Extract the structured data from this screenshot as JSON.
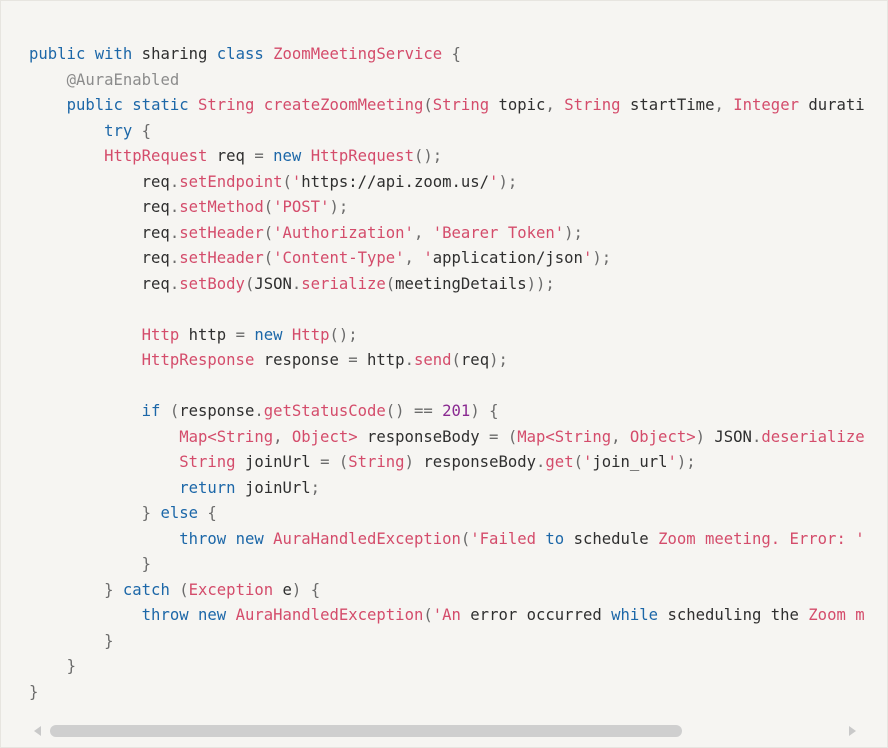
{
  "code_lines": [
    [
      [
        "kw",
        "public"
      ],
      [
        "plain",
        " "
      ],
      [
        "kw",
        "with"
      ],
      [
        "plain",
        " sharing "
      ],
      [
        "kw",
        "class"
      ],
      [
        "plain",
        " "
      ],
      [
        "ty",
        "ZoomMeetingService"
      ],
      [
        "plain",
        " "
      ],
      [
        "pun",
        "{"
      ]
    ],
    [
      [
        "plain",
        "    "
      ],
      [
        "ann",
        "@AuraEnabled"
      ]
    ],
    [
      [
        "plain",
        "    "
      ],
      [
        "kw",
        "public"
      ],
      [
        "plain",
        " "
      ],
      [
        "kw",
        "static"
      ],
      [
        "plain",
        " "
      ],
      [
        "ty",
        "String"
      ],
      [
        "plain",
        " "
      ],
      [
        "fn",
        "createZoomMeeting"
      ],
      [
        "pun",
        "("
      ],
      [
        "ty",
        "String"
      ],
      [
        "plain",
        " topic"
      ],
      [
        "pun",
        ", "
      ],
      [
        "ty",
        "String"
      ],
      [
        "plain",
        " startTime"
      ],
      [
        "pun",
        ", "
      ],
      [
        "ty",
        "Integer"
      ],
      [
        "plain",
        " durati"
      ]
    ],
    [
      [
        "plain",
        "        "
      ],
      [
        "kw",
        "try"
      ],
      [
        "plain",
        " "
      ],
      [
        "pun",
        "{"
      ]
    ],
    [
      [
        "plain",
        "        "
      ],
      [
        "ty",
        "HttpRequest"
      ],
      [
        "plain",
        " req "
      ],
      [
        "pun",
        "="
      ],
      [
        "plain",
        " "
      ],
      [
        "kw",
        "new"
      ],
      [
        "plain",
        " "
      ],
      [
        "ty",
        "HttpRequest"
      ],
      [
        "pun",
        "();"
      ]
    ],
    [
      [
        "plain",
        "            req"
      ],
      [
        "pun",
        "."
      ],
      [
        "fn",
        "setEndpoint"
      ],
      [
        "pun",
        "("
      ],
      [
        "q",
        "'"
      ],
      [
        "str",
        "https://api.zoom.us/"
      ],
      [
        "q",
        "'"
      ],
      [
        "pun",
        ");"
      ]
    ],
    [
      [
        "plain",
        "            req"
      ],
      [
        "pun",
        "."
      ],
      [
        "fn",
        "setMethod"
      ],
      [
        "pun",
        "("
      ],
      [
        "q",
        "'"
      ],
      [
        "q",
        "POST"
      ],
      [
        "q",
        "'"
      ],
      [
        "pun",
        ");"
      ]
    ],
    [
      [
        "plain",
        "            req"
      ],
      [
        "pun",
        "."
      ],
      [
        "fn",
        "setHeader"
      ],
      [
        "pun",
        "("
      ],
      [
        "q",
        "'Authorization'"
      ],
      [
        "pun",
        ", "
      ],
      [
        "q",
        "'Bearer Token'"
      ],
      [
        "pun",
        ");"
      ]
    ],
    [
      [
        "plain",
        "            req"
      ],
      [
        "pun",
        "."
      ],
      [
        "fn",
        "setHeader"
      ],
      [
        "pun",
        "("
      ],
      [
        "q",
        "'Content-Type'"
      ],
      [
        "pun",
        ", "
      ],
      [
        "q",
        "'"
      ],
      [
        "str",
        "application/json"
      ],
      [
        "q",
        "'"
      ],
      [
        "pun",
        ");"
      ]
    ],
    [
      [
        "plain",
        "            req"
      ],
      [
        "pun",
        "."
      ],
      [
        "fn",
        "setBody"
      ],
      [
        "pun",
        "("
      ],
      [
        "plain",
        "JSON"
      ],
      [
        "pun",
        "."
      ],
      [
        "fn",
        "serialize"
      ],
      [
        "pun",
        "("
      ],
      [
        "plain",
        "meetingDetails"
      ],
      [
        "pun",
        "));"
      ]
    ],
    [
      [
        "plain",
        ""
      ]
    ],
    [
      [
        "plain",
        "            "
      ],
      [
        "ty",
        "Http"
      ],
      [
        "plain",
        " http "
      ],
      [
        "pun",
        "="
      ],
      [
        "plain",
        " "
      ],
      [
        "kw",
        "new"
      ],
      [
        "plain",
        " "
      ],
      [
        "ty",
        "Http"
      ],
      [
        "pun",
        "();"
      ]
    ],
    [
      [
        "plain",
        "            "
      ],
      [
        "ty",
        "HttpResponse"
      ],
      [
        "plain",
        " response "
      ],
      [
        "pun",
        "="
      ],
      [
        "plain",
        " http"
      ],
      [
        "pun",
        "."
      ],
      [
        "fn",
        "send"
      ],
      [
        "pun",
        "("
      ],
      [
        "plain",
        "req"
      ],
      [
        "pun",
        ");"
      ]
    ],
    [
      [
        "plain",
        ""
      ]
    ],
    [
      [
        "plain",
        "            "
      ],
      [
        "kw",
        "if"
      ],
      [
        "plain",
        " "
      ],
      [
        "pun",
        "("
      ],
      [
        "plain",
        "response"
      ],
      [
        "pun",
        "."
      ],
      [
        "fn",
        "getStatusCode"
      ],
      [
        "pun",
        "()"
      ],
      [
        "plain",
        " "
      ],
      [
        "pun",
        "=="
      ],
      [
        "plain",
        " "
      ],
      [
        "num",
        "201"
      ],
      [
        "pun",
        ")"
      ],
      [
        "plain",
        " "
      ],
      [
        "pun",
        "{"
      ]
    ],
    [
      [
        "plain",
        "                "
      ],
      [
        "ty",
        "Map<String"
      ],
      [
        "pun",
        ", "
      ],
      [
        "ty",
        "Object>"
      ],
      [
        "plain",
        " responseBody "
      ],
      [
        "pun",
        "="
      ],
      [
        "plain",
        " "
      ],
      [
        "pun",
        "("
      ],
      [
        "ty",
        "Map<String"
      ],
      [
        "pun",
        ", "
      ],
      [
        "ty",
        "Object>"
      ],
      [
        "pun",
        ")"
      ],
      [
        "plain",
        " JSON"
      ],
      [
        "pun",
        "."
      ],
      [
        "fn",
        "deserialize"
      ]
    ],
    [
      [
        "plain",
        "                "
      ],
      [
        "ty",
        "String"
      ],
      [
        "plain",
        " joinUrl "
      ],
      [
        "pun",
        "="
      ],
      [
        "plain",
        " "
      ],
      [
        "pun",
        "("
      ],
      [
        "ty",
        "String"
      ],
      [
        "pun",
        ")"
      ],
      [
        "plain",
        " responseBody"
      ],
      [
        "pun",
        "."
      ],
      [
        "fn",
        "get"
      ],
      [
        "pun",
        "("
      ],
      [
        "q",
        "'"
      ],
      [
        "str",
        "join_url"
      ],
      [
        "q",
        "'"
      ],
      [
        "pun",
        ");"
      ]
    ],
    [
      [
        "plain",
        "                "
      ],
      [
        "kw",
        "return"
      ],
      [
        "plain",
        " joinUrl"
      ],
      [
        "pun",
        ";"
      ]
    ],
    [
      [
        "plain",
        "            "
      ],
      [
        "pun",
        "}"
      ],
      [
        "plain",
        " "
      ],
      [
        "kw",
        "else"
      ],
      [
        "plain",
        " "
      ],
      [
        "pun",
        "{"
      ]
    ],
    [
      [
        "plain",
        "                "
      ],
      [
        "kw",
        "throw"
      ],
      [
        "plain",
        " "
      ],
      [
        "kw",
        "new"
      ],
      [
        "plain",
        " "
      ],
      [
        "ty",
        "AuraHandledException"
      ],
      [
        "pun",
        "("
      ],
      [
        "q",
        "'Failed "
      ],
      [
        "kw",
        "to"
      ],
      [
        "q",
        " "
      ],
      [
        "str",
        "schedule "
      ],
      [
        "q",
        "Zoom meeting. Error: '"
      ]
    ],
    [
      [
        "plain",
        "            "
      ],
      [
        "pun",
        "}"
      ]
    ],
    [
      [
        "plain",
        "        "
      ],
      [
        "pun",
        "}"
      ],
      [
        "plain",
        " "
      ],
      [
        "kw",
        "catch"
      ],
      [
        "plain",
        " "
      ],
      [
        "pun",
        "("
      ],
      [
        "ty",
        "Exception"
      ],
      [
        "plain",
        " e"
      ],
      [
        "pun",
        ")"
      ],
      [
        "plain",
        " "
      ],
      [
        "pun",
        "{"
      ]
    ],
    [
      [
        "plain",
        "            "
      ],
      [
        "kw",
        "throw"
      ],
      [
        "plain",
        " "
      ],
      [
        "kw",
        "new"
      ],
      [
        "plain",
        " "
      ],
      [
        "ty",
        "AuraHandledException"
      ],
      [
        "pun",
        "("
      ],
      [
        "q",
        "'An "
      ],
      [
        "str",
        "error occurred "
      ],
      [
        "kw",
        "while"
      ],
      [
        "str",
        " scheduling the "
      ],
      [
        "q",
        "Zoom m"
      ]
    ],
    [
      [
        "plain",
        "        "
      ],
      [
        "pun",
        "}"
      ]
    ],
    [
      [
        "plain",
        "    "
      ],
      [
        "pun",
        "}"
      ]
    ],
    [
      [
        "pun",
        "}"
      ]
    ]
  ],
  "scroll": {
    "position": 0,
    "visible_fraction": 0.8
  }
}
